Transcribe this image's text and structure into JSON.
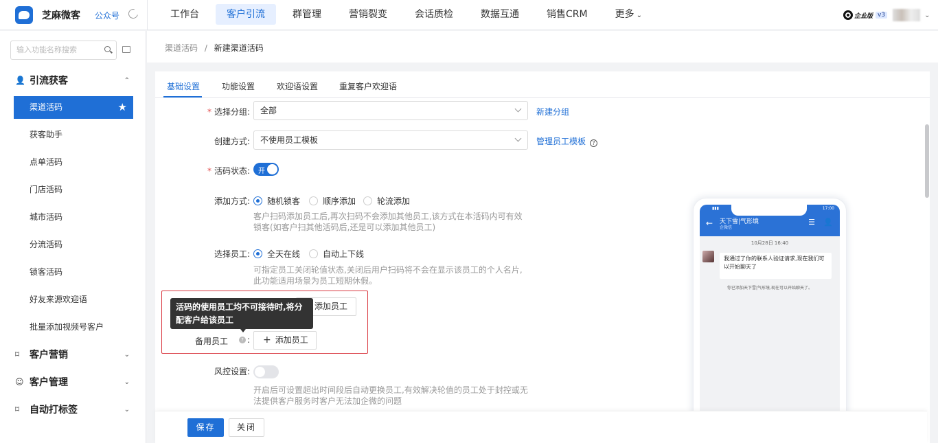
{
  "app": {
    "brand": "芝麻微客",
    "gzh": "公众号"
  },
  "nav": [
    "工作台",
    "客户引流",
    "群管理",
    "营销裂变",
    "会话质检",
    "数据互通",
    "销售CRM",
    "更多"
  ],
  "nav_active": "客户引流",
  "topright": {
    "edition": "企业版",
    "version": "v3"
  },
  "sidebar": {
    "search_placeholder": "输入功能名称搜索",
    "group_traffic": "引流获客",
    "items": [
      "渠道活码",
      "获客助手",
      "点单活码",
      "门店活码",
      "城市活码",
      "分流活码",
      "锁客活码",
      "好友来源欢迎语",
      "批量添加视频号客户"
    ],
    "group_marketing": "客户营销",
    "group_customer": "客户管理",
    "group_tags": "自动打标签"
  },
  "breadcrumb": {
    "parent": "渠道活码",
    "sep": "/",
    "current": "新建渠道活码"
  },
  "tabs": [
    "基础设置",
    "功能设置",
    "欢迎语设置",
    "重复客户欢迎语"
  ],
  "form": {
    "group_label": "选择分组:",
    "group_value": "全部",
    "new_group": "新建分组",
    "create_label": "创建方式:",
    "create_value": "不使用员工模板",
    "manage_tpl": "管理员工模板",
    "status_label": "活码状态:",
    "status_on": "开",
    "add_label": "添加方式:",
    "add_opts": [
      "随机锁客",
      "顺序添加",
      "轮流添加"
    ],
    "add_hint1": "客户扫码添加员工后,再次扫码不会添加其他员工,该方式在本活码内可有效",
    "add_hint2": "锁客(如客户扫其他活码后,还是可以添加其他员工)",
    "staff_label": "选择员工:",
    "staff_opts": [
      "全天在线",
      "自动上下线"
    ],
    "staff_hint1": "可指定员工关闭轮值状态,关闭后用户扫码将不会在显示该员工的个人名片,",
    "staff_hint2": "此功能适用场景为员工短期休假。",
    "add_staff": "添加员工",
    "tooltip": "活码的使用员工均不可接待时,将分配客户给该员工",
    "backup_label": "备用员工",
    "risk_label": "风控设置:",
    "risk_hint1": "开启后可设置超出时间段后自动更换员工,有效解决轮值的员工处于封控或无",
    "risk_hint2": "法提供客户服务时客户无法加企微的问题"
  },
  "preview": {
    "time": "17:00",
    "chat_title": "天下雪|气形境",
    "chat_sub": "企微信",
    "timestamp": "10月28日 16:40",
    "bubble": "我通过了你的联系人验证请求,现在我们可以开始聊天了",
    "sysmsg": "你已添加天下雪|气形境,现在可以开始聊天了。"
  },
  "footer": {
    "save": "保存",
    "close": "关闭"
  }
}
